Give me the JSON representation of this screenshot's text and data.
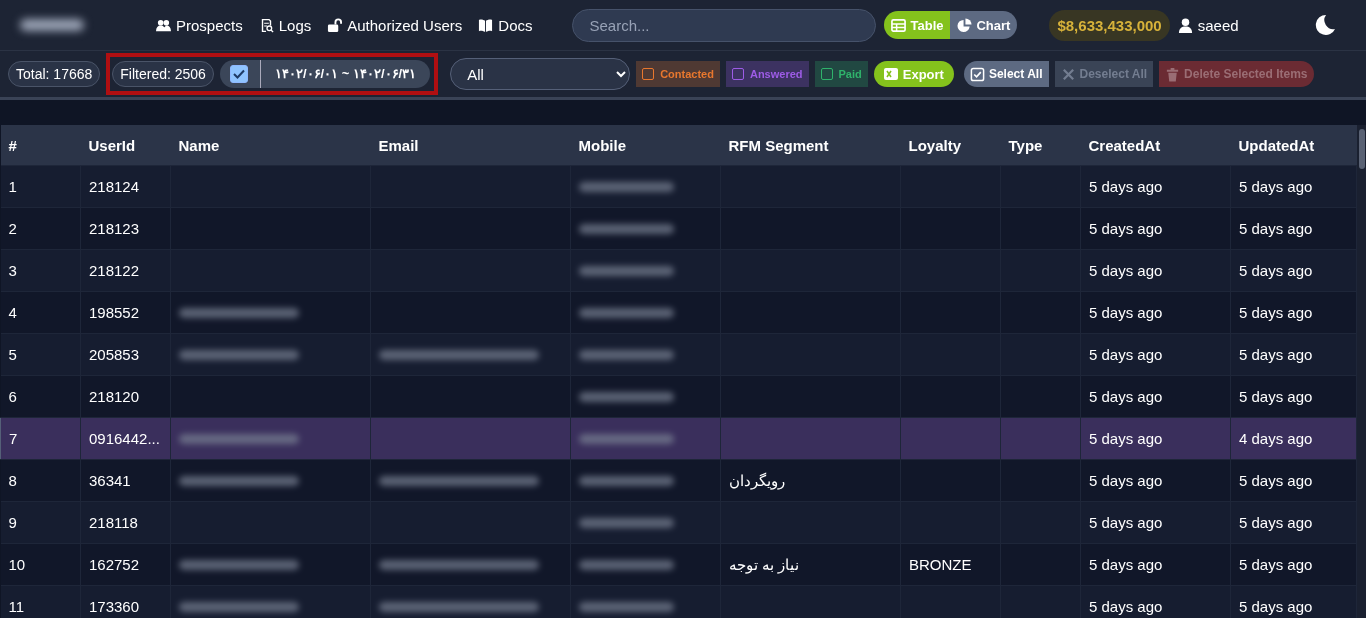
{
  "navbar": {
    "logo_blurred": true,
    "links": [
      {
        "label": "Prospects"
      },
      {
        "label": "Logs"
      },
      {
        "label": "Authorized Users"
      },
      {
        "label": "Docs"
      }
    ],
    "search": {
      "placeholder": "Search..."
    },
    "view_toggle": [
      {
        "label": "Table",
        "selected": true
      },
      {
        "label": "Chart",
        "selected": false
      }
    ],
    "balance": "$8,633,433,000",
    "user": "saeed"
  },
  "toolbar": {
    "total": "Total: 17668",
    "filtered": "Filtered: 2506",
    "date_filter": {
      "checked": true,
      "range": "۱۴۰۲/۰۶/۰۱ ~ ۱۴۰۲/۰۶/۳۱"
    },
    "highlighted": true,
    "select": {
      "value": "All"
    },
    "status_filters": [
      {
        "label": "Contacted",
        "checked": false,
        "color": "#e8772e"
      },
      {
        "label": "Answered",
        "checked": false,
        "color": "#9d5ce6"
      },
      {
        "label": "Paid",
        "checked": false,
        "color": "#2fb36b"
      }
    ],
    "export": "Export",
    "actions": [
      {
        "label": "Select All",
        "disabled": false
      },
      {
        "label": "Deselect All",
        "disabled": true
      },
      {
        "label": "Delete Selected Items",
        "disabled": true
      }
    ]
  },
  "table": {
    "columns": [
      "#",
      "UserId",
      "Name",
      "Email",
      "Mobile",
      "RFM Segment",
      "Loyalty",
      "Type",
      "CreatedAt",
      "UpdatedAt"
    ],
    "rows": [
      {
        "index": "1",
        "user_id": "218124",
        "name_blurred": false,
        "email_blurred": false,
        "mobile_blurred": true,
        "created": "5 days ago",
        "updated": "5 days ago",
        "selected": false
      },
      {
        "index": "2",
        "user_id": "218123",
        "name_blurred": false,
        "email_blurred": false,
        "mobile_blurred": true,
        "created": "5 days ago",
        "updated": "5 days ago",
        "selected": false
      },
      {
        "index": "3",
        "user_id": "218122",
        "name_blurred": false,
        "email_blurred": false,
        "mobile_blurred": true,
        "created": "5 days ago",
        "updated": "5 days ago",
        "selected": false
      },
      {
        "index": "4",
        "user_id": "198552",
        "name_blurred": true,
        "email_blurred": false,
        "mobile_blurred": true,
        "created": "5 days ago",
        "updated": "5 days ago",
        "selected": false
      },
      {
        "index": "5",
        "user_id": "205853",
        "name_blurred": true,
        "email_blurred": true,
        "mobile_blurred": true,
        "created": "5 days ago",
        "updated": "5 days ago",
        "selected": false
      },
      {
        "index": "6",
        "user_id": "218120",
        "name_blurred": false,
        "email_blurred": false,
        "mobile_blurred": true,
        "created": "5 days ago",
        "updated": "5 days ago",
        "selected": false
      },
      {
        "index": "7",
        "user_id": "0916442...",
        "name_blurred": true,
        "email_blurred": false,
        "mobile_blurred": true,
        "created": "5 days ago",
        "updated": "4 days ago",
        "selected": true
      },
      {
        "index": "8",
        "user_id": "36341",
        "name_blurred": true,
        "email_blurred": true,
        "mobile_blurred": true,
        "rfm": "رویگردان",
        "created": "5 days ago",
        "updated": "5 days ago",
        "selected": false
      },
      {
        "index": "9",
        "user_id": "218118",
        "name_blurred": false,
        "email_blurred": false,
        "mobile_blurred": true,
        "created": "5 days ago",
        "updated": "5 days ago",
        "selected": false
      },
      {
        "index": "10",
        "user_id": "162752",
        "name_blurred": true,
        "email_blurred": true,
        "mobile_blurred": true,
        "rfm": "نیاز به توجه",
        "loyalty": "BRONZE",
        "created": "5 days ago",
        "updated": "5 days ago",
        "selected": false
      },
      {
        "index": "11",
        "user_id": "173360",
        "name_blurred": true,
        "email_blurred": true,
        "mobile_blurred": true,
        "created": "5 days ago",
        "updated": "5 days ago",
        "selected": false
      }
    ]
  }
}
